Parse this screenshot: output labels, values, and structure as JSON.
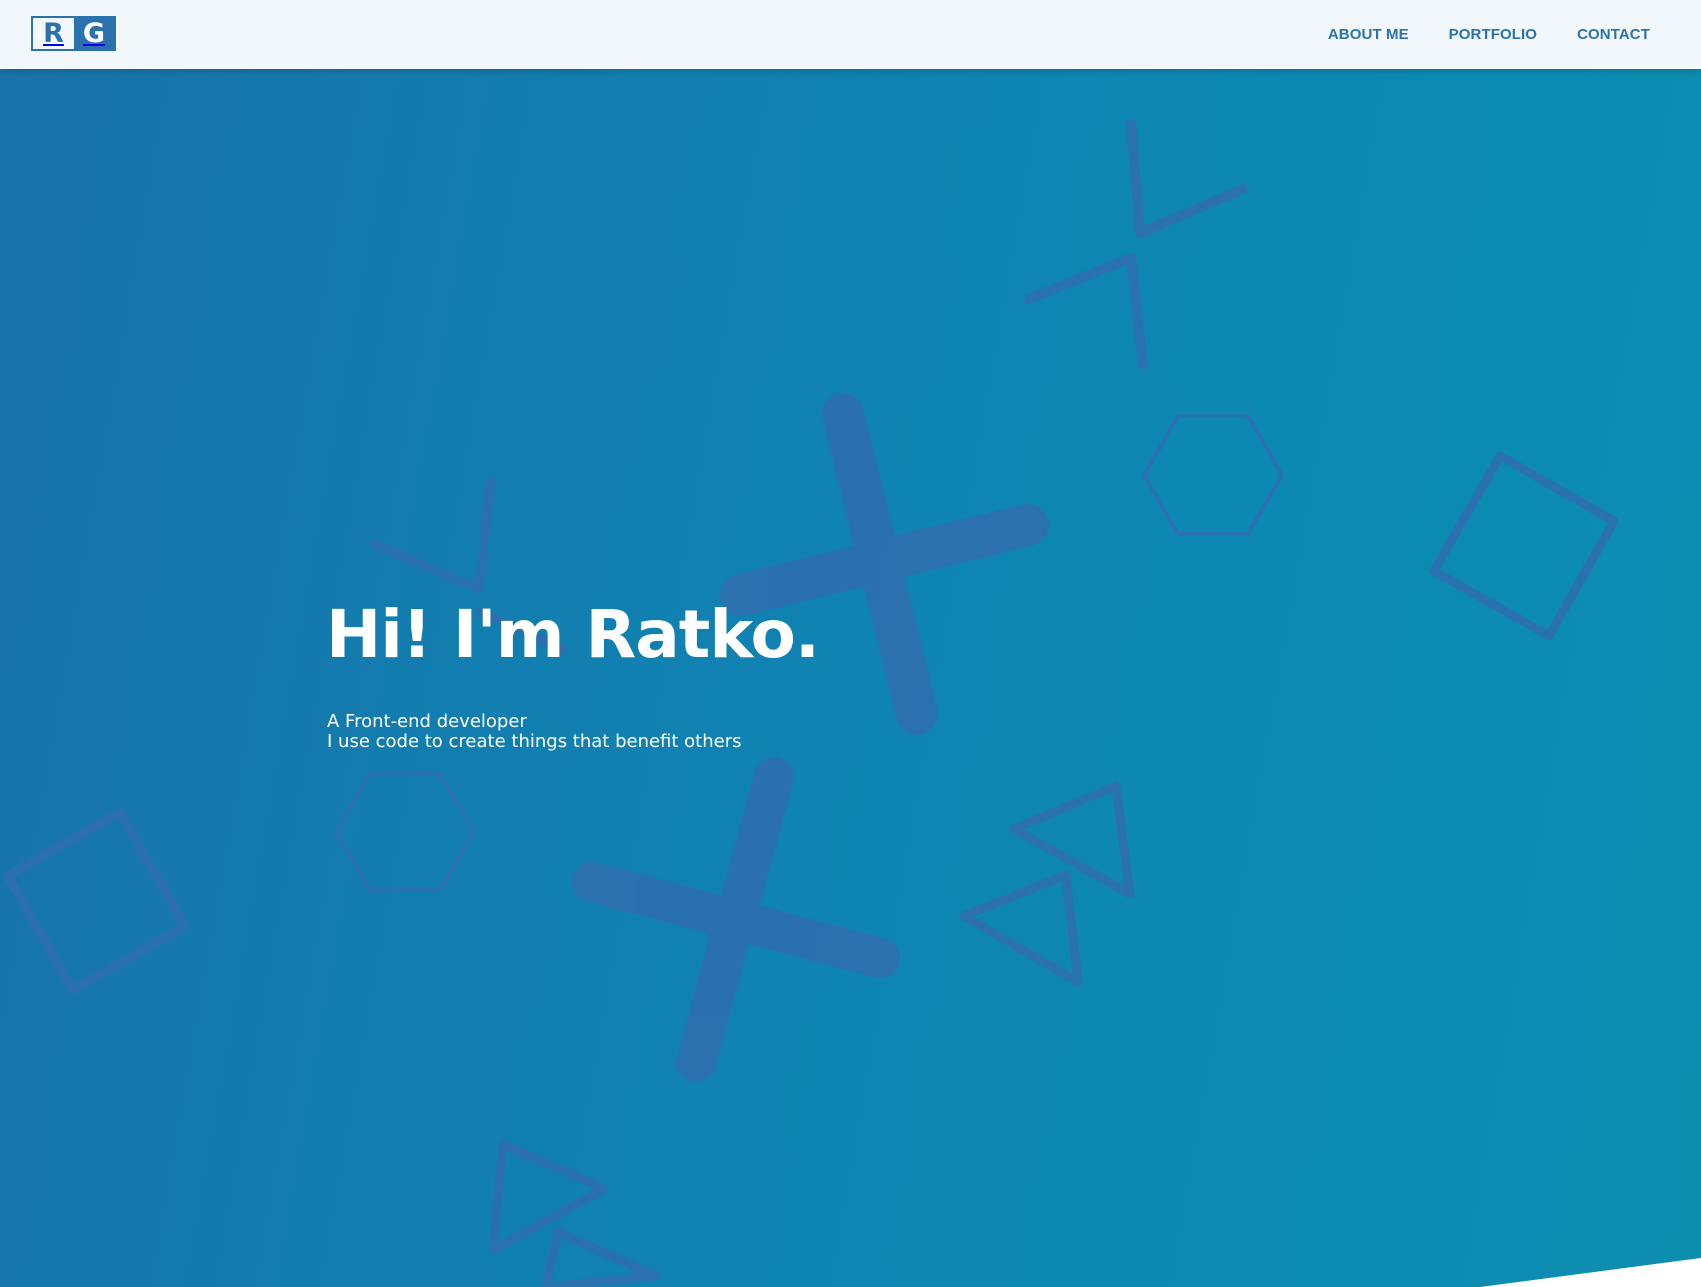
{
  "header": {
    "logo": {
      "letter_left": "R",
      "letter_right": "G"
    },
    "nav": [
      {
        "label": "ABOUT ME"
      },
      {
        "label": "PORTFOLIO"
      },
      {
        "label": "CONTACT"
      }
    ]
  },
  "hero": {
    "title": "Hi! I'm Ratko.",
    "subtitle_line1": "A Front-end developer",
    "subtitle_line2": "I use code to create things that benefit others"
  },
  "colors": {
    "accent": "#2a72ad",
    "header_bg": "#f2f7fb",
    "hero_gradient_start": "#1a72aa",
    "hero_gradient_end": "#0d8fb0",
    "shape_color": "#2e6fae",
    "text_on_hero": "#ffffff"
  },
  "decorations": [
    "large-cross-icon",
    "large-cross-icon",
    "chevron-icon",
    "chevron-icon",
    "hexagon-outline-icon",
    "hexagon-outline-icon",
    "square-outline-icon",
    "square-outline-icon",
    "triangle-outline-icon",
    "triangle-outline-icon",
    "triangle-outline-icon",
    "triangle-outline-icon"
  ]
}
